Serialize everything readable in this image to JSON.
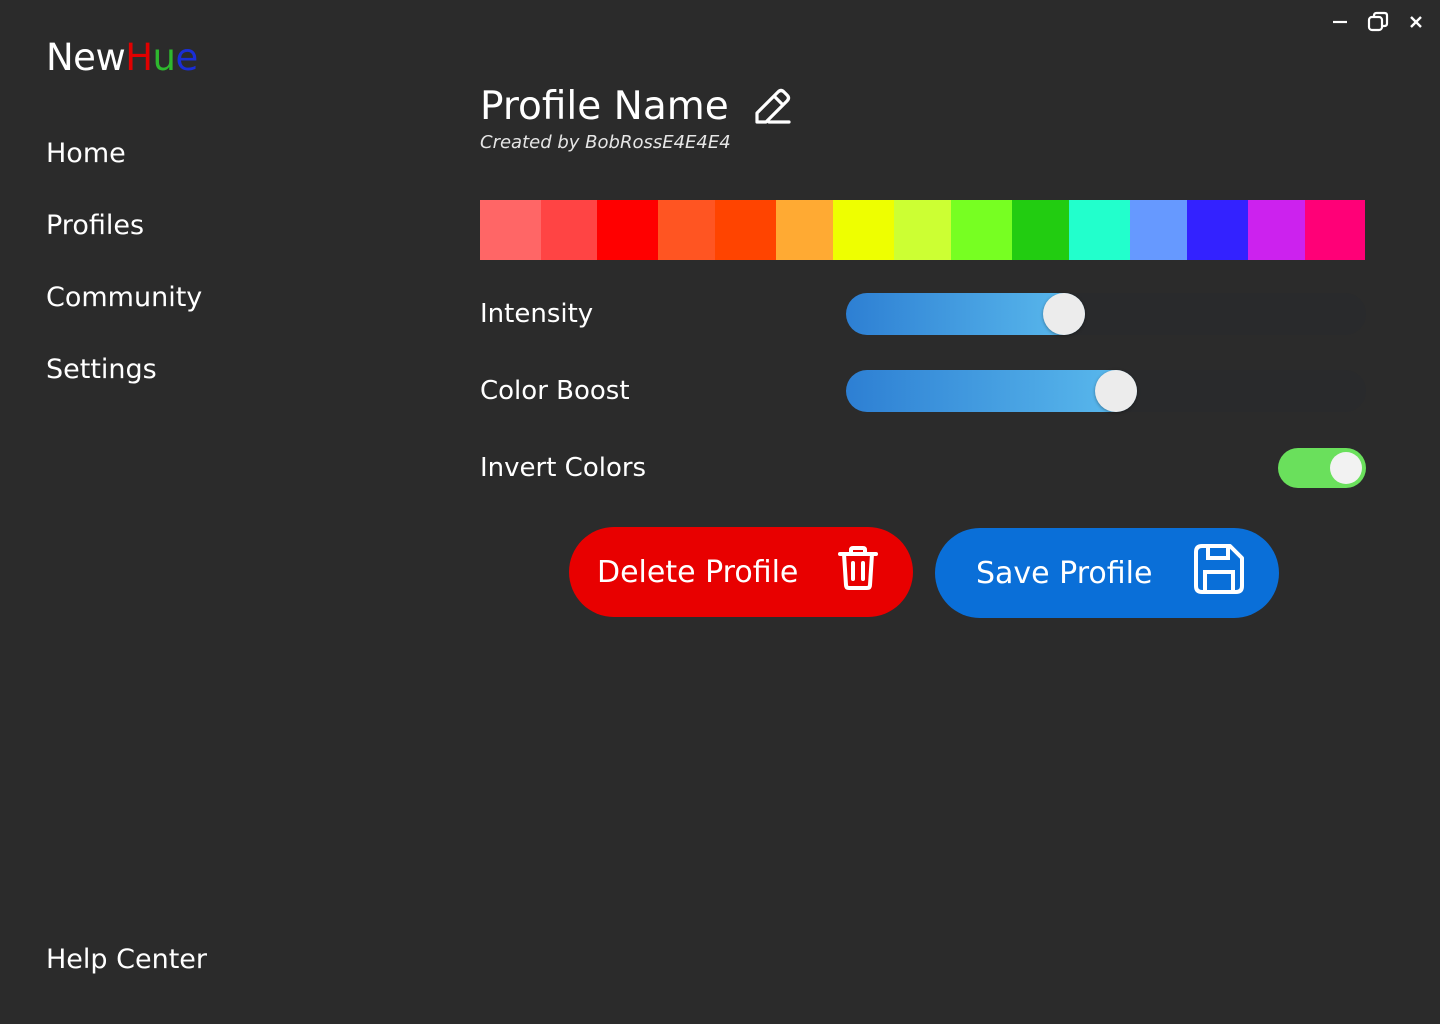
{
  "window": {
    "controls": [
      "minimize-icon",
      "restore-icon",
      "close-icon"
    ]
  },
  "app": {
    "logo": [
      {
        "text": "New",
        "color": "#ffffff"
      },
      {
        "text": "H",
        "color": "#e00000"
      },
      {
        "text": "u",
        "color": "#2eb82e"
      },
      {
        "text": "e",
        "color": "#1a2ed6"
      }
    ]
  },
  "sidebar": {
    "items": [
      {
        "label": "Home",
        "active": false
      },
      {
        "label": "Profiles",
        "active": true
      },
      {
        "label": "Community",
        "active": false
      },
      {
        "label": "Settings",
        "active": false
      }
    ],
    "help_label": "Help Center"
  },
  "profile": {
    "name": "Profile Name",
    "created_by": "Created by BobRossE4E4E4",
    "palette": [
      "#ff6666",
      "#ff4444",
      "#ff0000",
      "#ff5522",
      "#ff4400",
      "#ffaa33",
      "#eeff00",
      "#ccff33",
      "#77ff22",
      "#22cc11",
      "#22ffcc",
      "#6699ff",
      "#3322ff",
      "#cc22ee",
      "#ff0077"
    ]
  },
  "controls": {
    "intensity": {
      "label": "Intensity",
      "value": 0.42
    },
    "color_boost": {
      "label": "Color Boost",
      "value": 0.52
    },
    "invert": {
      "label": "Invert Colors",
      "on": true
    }
  },
  "actions": {
    "delete_label": "Delete Profile",
    "save_label": "Save Profile",
    "delete_color": "#e80000",
    "save_color": "#0a6fd8"
  }
}
